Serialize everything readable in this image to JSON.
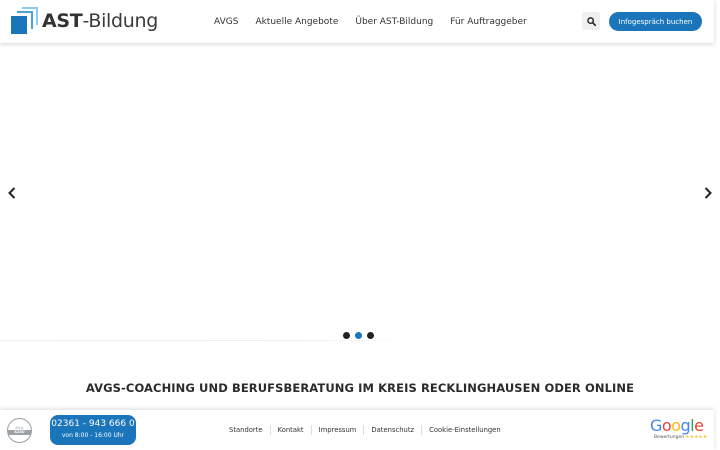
{
  "header": {
    "logo": {
      "bold": "AST",
      "rest": "-Bildung"
    },
    "nav": [
      "AVGS",
      "Aktuelle Angebote",
      "Über AST-Bildung",
      "Für Auftraggeber"
    ],
    "search_icon": "search-icon",
    "cta_label": "Infogespräch buchen"
  },
  "slider": {
    "prev_icon": "chevron-left-icon",
    "next_icon": "chevron-right-icon",
    "dots": 3,
    "active_dot": 1
  },
  "main": {
    "headline": "AVGS-COACHING UND BERUFSBERATUNG IM KREIS RECKLINGHAUSEN ODER ONLINE"
  },
  "footer": {
    "seal": {
      "ring": "ASA",
      "band": "AZAV"
    },
    "phone": {
      "number": "02361 - 943 666 0",
      "hours": "von 8:00 - 16:00 Uhr"
    },
    "links": [
      "Standorte",
      "Kontakt",
      "Impressum",
      "Datenschutz",
      "Cookie-Einstellungen"
    ],
    "google": {
      "word": "Google",
      "sub": "Bewertungen"
    }
  },
  "colors": {
    "accent": "#1b75bb",
    "text": "#333333"
  }
}
